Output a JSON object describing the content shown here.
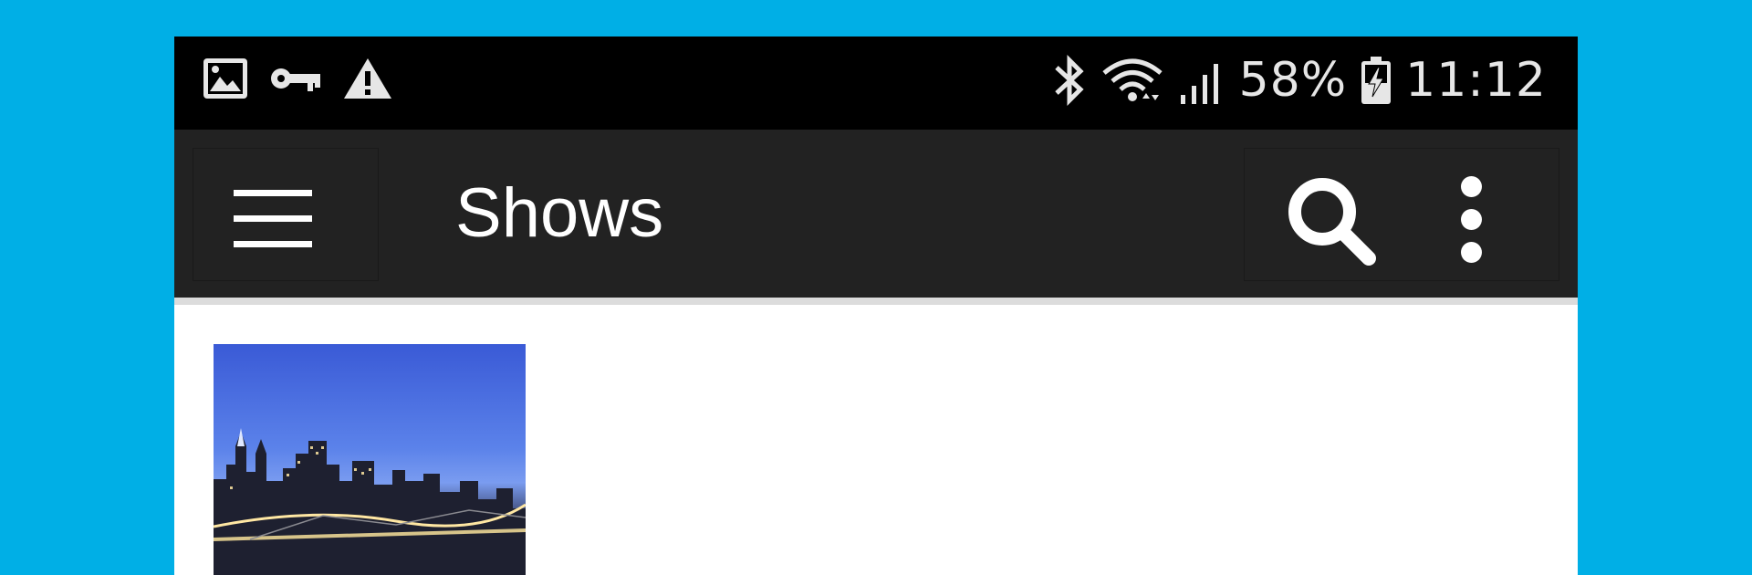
{
  "statusbar": {
    "left_icons": [
      "image-icon",
      "key-icon",
      "warning-icon"
    ],
    "right_icons": [
      "bluetooth-icon",
      "wifi-icon",
      "signal-icon",
      "battery-charging-icon"
    ],
    "battery": "58%",
    "time": "11:12"
  },
  "appbar": {
    "title": "Shows",
    "menu_icon": "hamburger-menu-icon",
    "search_icon": "search-icon",
    "more_icon": "more-vertical-icon"
  },
  "show": {
    "thumbnail": "city-skyline-bridge-thumbnail"
  },
  "colors": {
    "background": "#00afe6",
    "statusbar": "#000000",
    "appbar": "#222222",
    "content": "#ffffff"
  }
}
